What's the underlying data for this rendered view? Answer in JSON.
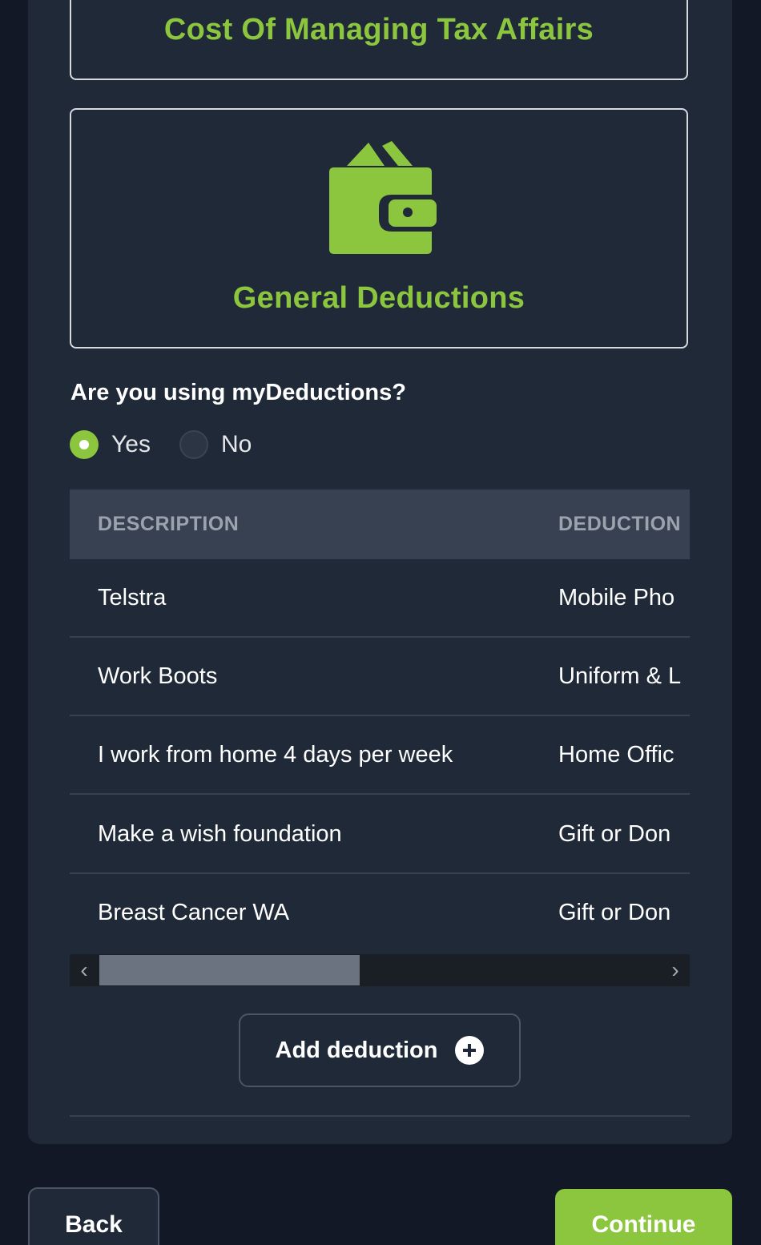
{
  "cards": {
    "prev_title": "Cost Of Managing Tax Affairs",
    "current_title": "General Deductions",
    "current_icon": "wallet-icon"
  },
  "question": {
    "label": "Are you using myDeductions?",
    "options": [
      "Yes",
      "No"
    ],
    "selected": "Yes"
  },
  "table": {
    "columns": [
      "DESCRIPTION",
      "DEDUCTION"
    ],
    "rows": [
      [
        "Telstra",
        "Mobile Pho"
      ],
      [
        "Work Boots",
        "Uniform & L"
      ],
      [
        "I work from home 4 days per week",
        "Home Offic"
      ],
      [
        "Make a wish foundation",
        "Gift or Don"
      ],
      [
        "Breast Cancer WA",
        "Gift or Don"
      ]
    ]
  },
  "actions": {
    "add_label": "Add deduction",
    "back_label": "Back",
    "continue_label": "Continue"
  },
  "colors": {
    "accent": "#8cc63f",
    "panel": "#1f2937",
    "background": "#121826"
  }
}
